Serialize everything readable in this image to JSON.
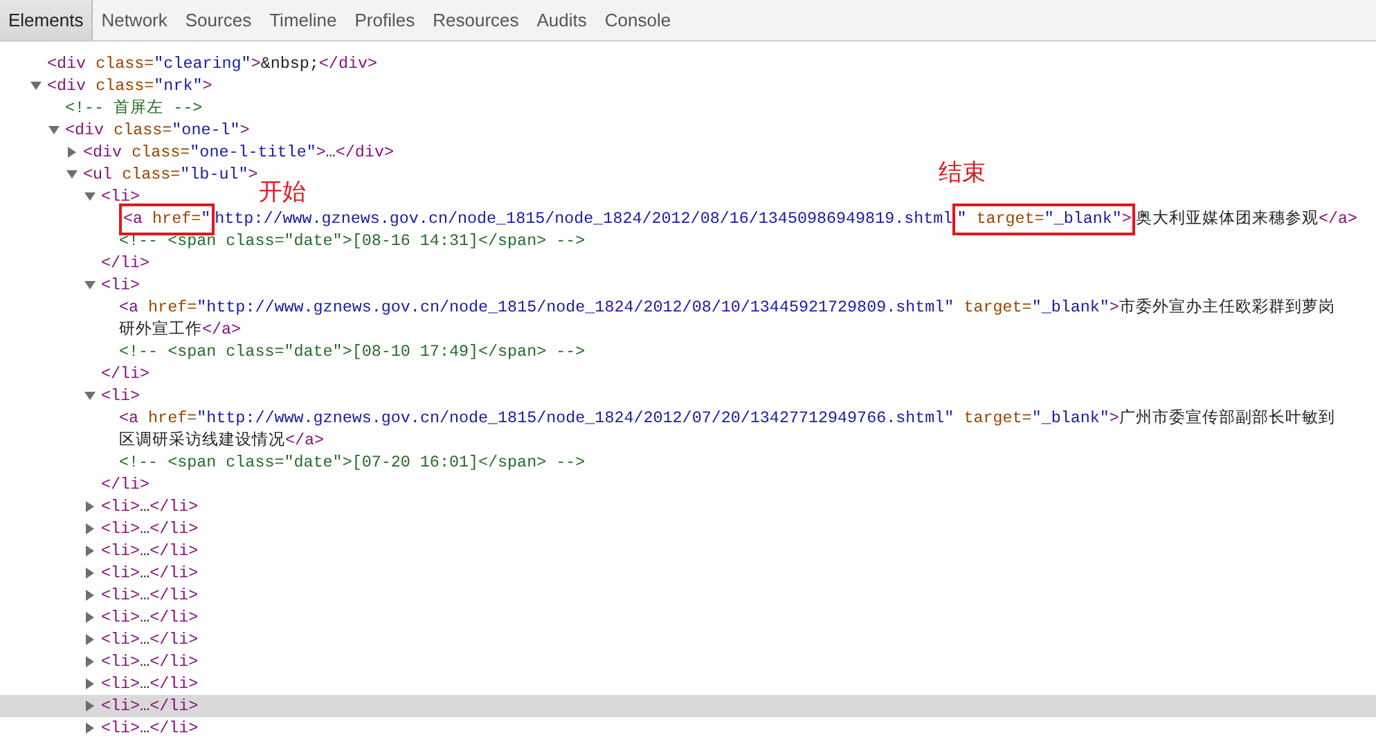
{
  "tabs": [
    {
      "label": "Elements",
      "selected": true
    },
    {
      "label": "Network",
      "selected": false
    },
    {
      "label": "Sources",
      "selected": false
    },
    {
      "label": "Timeline",
      "selected": false
    },
    {
      "label": "Profiles",
      "selected": false
    },
    {
      "label": "Resources",
      "selected": false
    },
    {
      "label": "Audits",
      "selected": false
    },
    {
      "label": "Console",
      "selected": false
    }
  ],
  "tree": [
    {
      "kind": "element",
      "selected": false,
      "lines": [
        "<div class=\"clearing\">&nbsp;</div>"
      ]
    },
    {
      "kind": "element",
      "selected": false,
      "expanded": true,
      "lines": [
        "<div class=\"nrk\">"
      ],
      "children": [
        {
          "kind": "comment",
          "selected": false,
          "lines": [
            "<!-- 首屏左 -->"
          ]
        },
        {
          "kind": "element",
          "selected": false,
          "expanded": true,
          "lines": [
            "<div class=\"one-l\">"
          ],
          "children": [
            {
              "kind": "element",
              "selected": false,
              "expanded": false,
              "lines": [
                "<div class=\"one-l-title\">…</div>"
              ]
            },
            {
              "kind": "element",
              "selected": false,
              "expanded": true,
              "lines": [
                "<ul class=\"lb-ul\">"
              ],
              "children": [
                {
                  "kind": "element",
                  "selected": false,
                  "expanded": true,
                  "lines": [
                    "<li>"
                  ],
                  "close": "</li>",
                  "children": [
                    {
                      "kind": "element",
                      "selected": false,
                      "lines": [
                        [
                          {
                            "text": "<a href=\"",
                            "callout": {
                              "label": "开始"
                            }
                          },
                          {
                            "text": "http://www.gznews.gov.cn/node_1815/node_1824/2012/08/16/13450986949819.shtml"
                          },
                          {
                            "text": "\" target=\"_blank\">",
                            "callout": {
                              "label": "结束"
                            }
                          },
                          {
                            "text": "奥大利亚媒体团来穗参观</a>"
                          }
                        ]
                      ]
                    },
                    {
                      "kind": "comment",
                      "selected": false,
                      "lines": [
                        "<!-- <span class=\"date\">[08-16 14:31]</span> -->"
                      ]
                    }
                  ]
                },
                {
                  "kind": "element",
                  "selected": false,
                  "expanded": true,
                  "lines": [
                    "<li>"
                  ],
                  "close": "</li>",
                  "children": [
                    {
                      "kind": "element",
                      "selected": false,
                      "lines": [
                        "<a href=\"http://www.gznews.gov.cn/node_1815/node_1824/2012/08/10/13445921729809.shtml\" target=\"_blank\">市委外宣办主任欧彩群到萝岗",
                        "研外宣工作</a>"
                      ]
                    },
                    {
                      "kind": "comment",
                      "selected": false,
                      "lines": [
                        "<!-- <span class=\"date\">[08-10 17:49]</span> -->"
                      ]
                    }
                  ]
                },
                {
                  "kind": "element",
                  "selected": false,
                  "expanded": true,
                  "lines": [
                    "<li>"
                  ],
                  "close": "</li>",
                  "children": [
                    {
                      "kind": "element",
                      "selected": false,
                      "lines": [
                        "<a href=\"http://www.gznews.gov.cn/node_1815/node_1824/2012/07/20/13427712949766.shtml\" target=\"_blank\">广州市委宣传部副部长叶敏到",
                        "区调研采访线建设情况</a>"
                      ]
                    },
                    {
                      "kind": "comment",
                      "selected": false,
                      "lines": [
                        "<!-- <span class=\"date\">[07-20 16:01]</span> -->"
                      ]
                    }
                  ]
                },
                {
                  "kind": "element",
                  "selected": false,
                  "expanded": false,
                  "lines": [
                    "<li>…</li>"
                  ]
                },
                {
                  "kind": "element",
                  "selected": false,
                  "expanded": false,
                  "lines": [
                    "<li>…</li>"
                  ]
                },
                {
                  "kind": "element",
                  "selected": false,
                  "expanded": false,
                  "lines": [
                    "<li>…</li>"
                  ]
                },
                {
                  "kind": "element",
                  "selected": false,
                  "expanded": false,
                  "lines": [
                    "<li>…</li>"
                  ]
                },
                {
                  "kind": "element",
                  "selected": false,
                  "expanded": false,
                  "lines": [
                    "<li>…</li>"
                  ]
                },
                {
                  "kind": "element",
                  "selected": false,
                  "expanded": false,
                  "lines": [
                    "<li>…</li>"
                  ]
                },
                {
                  "kind": "element",
                  "selected": false,
                  "expanded": false,
                  "lines": [
                    "<li>…</li>"
                  ]
                },
                {
                  "kind": "element",
                  "selected": false,
                  "expanded": false,
                  "lines": [
                    "<li>…</li>"
                  ]
                },
                {
                  "kind": "element",
                  "selected": false,
                  "expanded": false,
                  "lines": [
                    "<li>…</li>"
                  ]
                },
                {
                  "kind": "element",
                  "selected": true,
                  "expanded": false,
                  "lines": [
                    "<li>…</li>"
                  ]
                },
                {
                  "kind": "element",
                  "selected": false,
                  "expanded": false,
                  "lines": [
                    "<li>…</li>"
                  ]
                }
              ]
            }
          ]
        }
      ]
    }
  ]
}
